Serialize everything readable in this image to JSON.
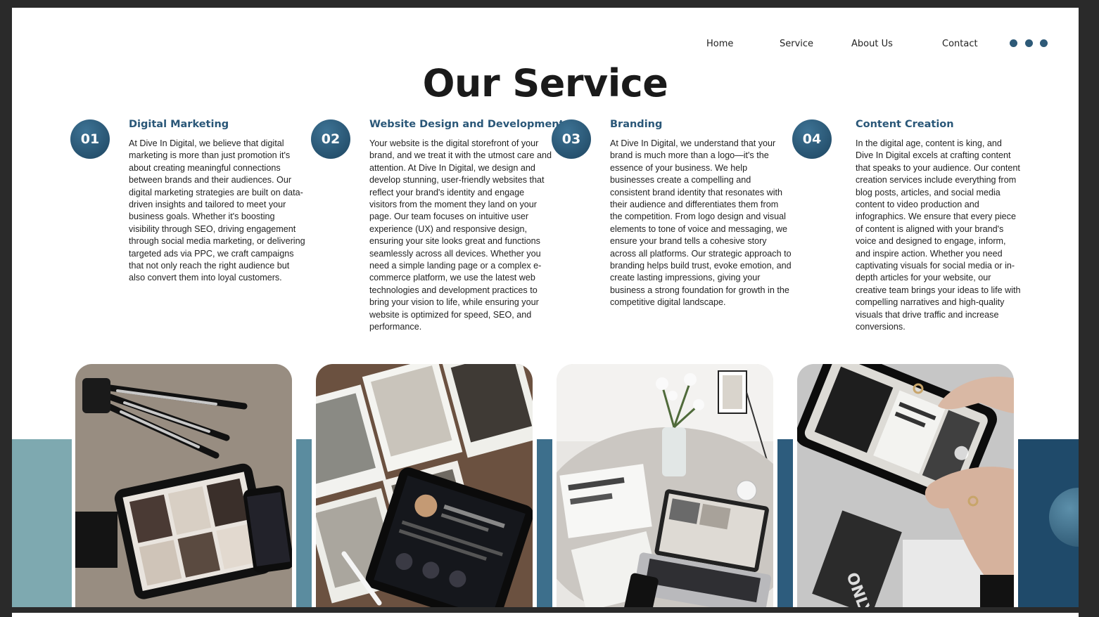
{
  "nav": {
    "items": [
      "Home",
      "Service",
      "About Us",
      "Contact"
    ]
  },
  "page_title": "Our Service",
  "services": [
    {
      "num": "01",
      "title": "Digital Marketing",
      "body": "At Dive In Digital, we believe that digital marketing is more than just promotion it's about creating meaningful connections between brands and their audiences. Our digital marketing strategies are built on data-driven insights and tailored to meet your business goals. Whether it's boosting visibility through SEO, driving engagement through social media marketing, or delivering targeted ads via PPC, we craft campaigns that not only reach the right audience but also convert them into loyal customers."
    },
    {
      "num": "02",
      "title": "Website Design and Development",
      "body": "Your website is the digital storefront of your brand, and we treat it with the utmost care and attention. At Dive In Digital, we design and develop stunning, user-friendly websites that reflect your brand's identity and engage visitors from the moment they land on your page. Our team focuses on intuitive user experience (UX) and responsive design, ensuring your site looks great and functions seamlessly across all devices. Whether you need a simple landing page or a complex e-commerce platform, we use the latest web technologies and development practices to bring your vision to life, while ensuring your website is optimized for speed, SEO, and performance."
    },
    {
      "num": "03",
      "title": "Branding",
      "body": "At Dive In Digital, we understand that your brand is much more than a logo—it's the essence of your business. We help businesses create a compelling and consistent brand identity that resonates with their audience and differentiates them from the competition. From logo design and visual elements to tone of voice and messaging, we ensure your brand tells a cohesive story across all platforms. Our strategic approach to branding helps build trust, evoke emotion, and create lasting impressions, giving your business a strong foundation for growth in the competitive digital landscape."
    },
    {
      "num": "04",
      "title": "Content Creation",
      "body": "In the digital age, content is king, and Dive In Digital excels at crafting content that speaks to your audience. Our content creation services include everything from blog posts, articles, and social media content to video production and infographics. We ensure that every piece of content is aligned with your brand's voice and designed to engage, inform, and inspire action. Whether you need captivating visuals for social media or in-depth articles for your website, our creative team brings your ideas to life with compelling narratives and high-quality visuals that drive traffic and increase conversions."
    }
  ],
  "colors": {
    "accent": "#2a5778",
    "band_1": "#7ea9b0",
    "band_2": "#5b8c9f",
    "band_3": "#3d6f8c",
    "band_4": "#2d5c7d",
    "band_5": "#1f4a6a"
  },
  "photos": [
    {
      "icon": "tablet-tripod-photo"
    },
    {
      "icon": "moodboard-tablet-photo"
    },
    {
      "icon": "desk-laptop-flowers-photo"
    },
    {
      "icon": "phone-camera-magazine-photo"
    }
  ]
}
